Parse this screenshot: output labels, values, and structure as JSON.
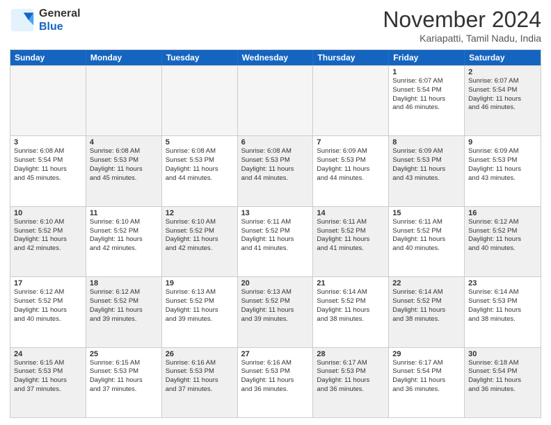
{
  "header": {
    "logo_line1": "General",
    "logo_line2": "Blue",
    "month": "November 2024",
    "location": "Kariapatti, Tamil Nadu, India"
  },
  "days_of_week": [
    "Sunday",
    "Monday",
    "Tuesday",
    "Wednesday",
    "Thursday",
    "Friday",
    "Saturday"
  ],
  "rows": [
    [
      {
        "day": "",
        "empty": true
      },
      {
        "day": "",
        "empty": true
      },
      {
        "day": "",
        "empty": true
      },
      {
        "day": "",
        "empty": true
      },
      {
        "day": "",
        "empty": true
      },
      {
        "day": "1",
        "sunrise": "6:07 AM",
        "sunset": "5:54 PM",
        "daylight": "11 hours and 46 minutes."
      },
      {
        "day": "2",
        "sunrise": "6:07 AM",
        "sunset": "5:54 PM",
        "daylight": "11 hours and 46 minutes.",
        "shaded": true
      }
    ],
    [
      {
        "day": "3",
        "sunrise": "6:08 AM",
        "sunset": "5:54 PM",
        "daylight": "11 hours and 45 minutes."
      },
      {
        "day": "4",
        "sunrise": "6:08 AM",
        "sunset": "5:53 PM",
        "daylight": "11 hours and 45 minutes.",
        "shaded": true
      },
      {
        "day": "5",
        "sunrise": "6:08 AM",
        "sunset": "5:53 PM",
        "daylight": "11 hours and 44 minutes."
      },
      {
        "day": "6",
        "sunrise": "6:08 AM",
        "sunset": "5:53 PM",
        "daylight": "11 hours and 44 minutes.",
        "shaded": true
      },
      {
        "day": "7",
        "sunrise": "6:09 AM",
        "sunset": "5:53 PM",
        "daylight": "11 hours and 44 minutes."
      },
      {
        "day": "8",
        "sunrise": "6:09 AM",
        "sunset": "5:53 PM",
        "daylight": "11 hours and 43 minutes.",
        "shaded": true
      },
      {
        "day": "9",
        "sunrise": "6:09 AM",
        "sunset": "5:53 PM",
        "daylight": "11 hours and 43 minutes."
      }
    ],
    [
      {
        "day": "10",
        "sunrise": "6:10 AM",
        "sunset": "5:52 PM",
        "daylight": "11 hours and 42 minutes.",
        "shaded": true
      },
      {
        "day": "11",
        "sunrise": "6:10 AM",
        "sunset": "5:52 PM",
        "daylight": "11 hours and 42 minutes."
      },
      {
        "day": "12",
        "sunrise": "6:10 AM",
        "sunset": "5:52 PM",
        "daylight": "11 hours and 42 minutes.",
        "shaded": true
      },
      {
        "day": "13",
        "sunrise": "6:11 AM",
        "sunset": "5:52 PM",
        "daylight": "11 hours and 41 minutes."
      },
      {
        "day": "14",
        "sunrise": "6:11 AM",
        "sunset": "5:52 PM",
        "daylight": "11 hours and 41 minutes.",
        "shaded": true
      },
      {
        "day": "15",
        "sunrise": "6:11 AM",
        "sunset": "5:52 PM",
        "daylight": "11 hours and 40 minutes."
      },
      {
        "day": "16",
        "sunrise": "6:12 AM",
        "sunset": "5:52 PM",
        "daylight": "11 hours and 40 minutes.",
        "shaded": true
      }
    ],
    [
      {
        "day": "17",
        "sunrise": "6:12 AM",
        "sunset": "5:52 PM",
        "daylight": "11 hours and 40 minutes."
      },
      {
        "day": "18",
        "sunrise": "6:12 AM",
        "sunset": "5:52 PM",
        "daylight": "11 hours and 39 minutes.",
        "shaded": true
      },
      {
        "day": "19",
        "sunrise": "6:13 AM",
        "sunset": "5:52 PM",
        "daylight": "11 hours and 39 minutes."
      },
      {
        "day": "20",
        "sunrise": "6:13 AM",
        "sunset": "5:52 PM",
        "daylight": "11 hours and 39 minutes.",
        "shaded": true
      },
      {
        "day": "21",
        "sunrise": "6:14 AM",
        "sunset": "5:52 PM",
        "daylight": "11 hours and 38 minutes."
      },
      {
        "day": "22",
        "sunrise": "6:14 AM",
        "sunset": "5:52 PM",
        "daylight": "11 hours and 38 minutes.",
        "shaded": true
      },
      {
        "day": "23",
        "sunrise": "6:14 AM",
        "sunset": "5:53 PM",
        "daylight": "11 hours and 38 minutes."
      }
    ],
    [
      {
        "day": "24",
        "sunrise": "6:15 AM",
        "sunset": "5:53 PM",
        "daylight": "11 hours and 37 minutes.",
        "shaded": true
      },
      {
        "day": "25",
        "sunrise": "6:15 AM",
        "sunset": "5:53 PM",
        "daylight": "11 hours and 37 minutes."
      },
      {
        "day": "26",
        "sunrise": "6:16 AM",
        "sunset": "5:53 PM",
        "daylight": "11 hours and 37 minutes.",
        "shaded": true
      },
      {
        "day": "27",
        "sunrise": "6:16 AM",
        "sunset": "5:53 PM",
        "daylight": "11 hours and 36 minutes."
      },
      {
        "day": "28",
        "sunrise": "6:17 AM",
        "sunset": "5:53 PM",
        "daylight": "11 hours and 36 minutes.",
        "shaded": true
      },
      {
        "day": "29",
        "sunrise": "6:17 AM",
        "sunset": "5:54 PM",
        "daylight": "11 hours and 36 minutes."
      },
      {
        "day": "30",
        "sunrise": "6:18 AM",
        "sunset": "5:54 PM",
        "daylight": "11 hours and 36 minutes.",
        "shaded": true
      }
    ]
  ]
}
